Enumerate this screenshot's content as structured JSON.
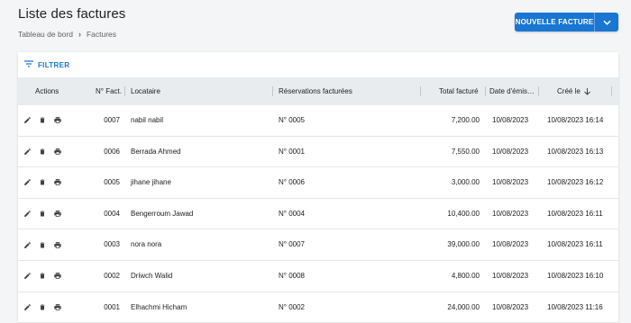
{
  "header": {
    "title": "Liste des factures",
    "breadcrumb": [
      "Tableau de bord",
      "Factures"
    ],
    "new_button_label": "NOUVELLE FACTURE"
  },
  "toolbar": {
    "filter_label": "FILTRER"
  },
  "table": {
    "columns": {
      "actions": "Actions",
      "number": "N° Fact.",
      "tenant": "Locataire",
      "reservations": "Réservations facturées",
      "total": "Total facturé",
      "issue_date": "Date d'émis…",
      "created": "Créé le"
    },
    "rows": [
      {
        "number": "0007",
        "tenant": "nabil nabil",
        "reservation": "N° 0005",
        "total": "7,200.00",
        "issue_date": "10/08/2023",
        "created": "10/08/2023 16:14"
      },
      {
        "number": "0006",
        "tenant": "Berrada Ahmed",
        "reservation": "N° 0001",
        "total": "7,550.00",
        "issue_date": "10/08/2023",
        "created": "10/08/2023 16:13"
      },
      {
        "number": "0005",
        "tenant": "jihane jihane",
        "reservation": "N° 0006",
        "total": "3,000.00",
        "issue_date": "10/08/2023",
        "created": "10/08/2023 16:12"
      },
      {
        "number": "0004",
        "tenant": "Bengerroum Jawad",
        "reservation": "N° 0004",
        "total": "10,400.00",
        "issue_date": "10/08/2023",
        "created": "10/08/2023 16:11"
      },
      {
        "number": "0003",
        "tenant": "nora nora",
        "reservation": "N° 0007",
        "total": "39,000.00",
        "issue_date": "10/08/2023",
        "created": "10/08/2023 16:11"
      },
      {
        "number": "0002",
        "tenant": "Driwch Walid",
        "reservation": "N° 0008",
        "total": "4,800.00",
        "issue_date": "10/08/2023",
        "created": "10/08/2023 16:10"
      },
      {
        "number": "0001",
        "tenant": "Elhachmi Hicham",
        "reservation": "N° 0002",
        "total": "24,000.00",
        "issue_date": "10/08/2023",
        "created": "10/08/2023 11:16"
      }
    ]
  },
  "colors": {
    "primary": "#1976d2",
    "header_bg": "#e8ecef",
    "page_bg": "#f4f5f7"
  }
}
